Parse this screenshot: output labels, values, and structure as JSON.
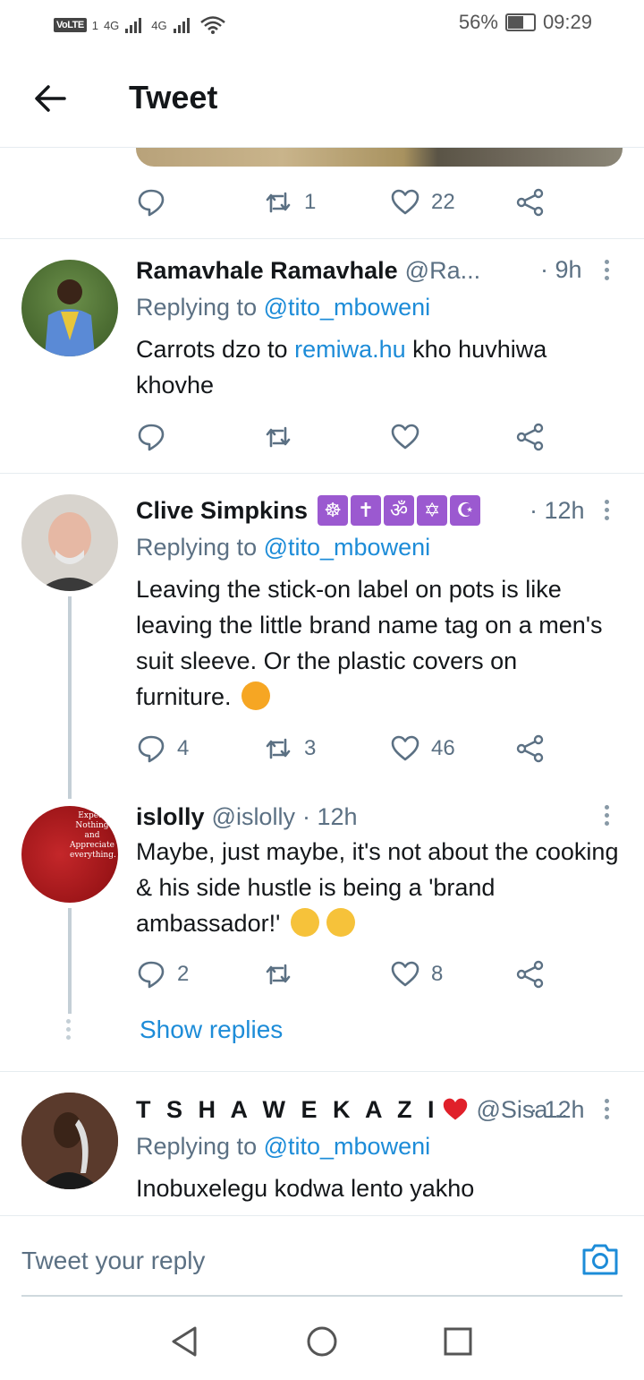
{
  "status_bar": {
    "volte": "VoLTE",
    "sim": "1",
    "network1": "4G",
    "network2": "4G",
    "battery": "56%",
    "time": "09:29"
  },
  "header": {
    "title": "Tweet"
  },
  "top_actions": {
    "replies": "",
    "retweets": "1",
    "likes": "22"
  },
  "tweets": [
    {
      "name": "Ramavhale Ramavhale",
      "handle": "@Ra...",
      "time": "· 9h",
      "replying_prefix": "Replying to",
      "replying_to": "@tito_mboweni",
      "text_before": "Carrots dzo to ",
      "link": "remiwa.hu",
      "text_after": " kho huvhiwa khovhe",
      "replies": "",
      "retweets": "",
      "likes": ""
    },
    {
      "name": "Clive Simpkins",
      "symbols": [
        "☸",
        "✝",
        "ॐ",
        "✡",
        "☪"
      ],
      "time": "· 12h",
      "replying_prefix": "Replying to",
      "replying_to": "@tito_mboweni",
      "text": "Leaving the stick-on label on pots is like leaving the little brand name tag on a men's suit sleeve. Or the plastic covers on furniture.",
      "replies": "4",
      "retweets": "3",
      "likes": "46"
    },
    {
      "name": "islolly",
      "handle": "@islolly",
      "time": "· 12h",
      "avatar_text": "Expect Nothing and Appreciate everything.",
      "text": "Maybe, just maybe, it's not about the cooking & his side hustle is being a 'brand ambassador!'",
      "replies": "2",
      "retweets": "",
      "likes": "8"
    },
    {
      "name": "T S H A W E K A Z I",
      "handle": "@Sisa...",
      "time": "· 12h",
      "replying_prefix": "Replying to",
      "replying_to": "@tito_mboweni",
      "text": "Inobuxelegu kodwa lento yakho"
    }
  ],
  "show_replies": "Show replies",
  "reply_bar": {
    "placeholder": "Tweet your reply"
  },
  "colors": {
    "accent": "#1d8cd8",
    "muted": "#5b7083",
    "divider": "#e6ecf0"
  }
}
